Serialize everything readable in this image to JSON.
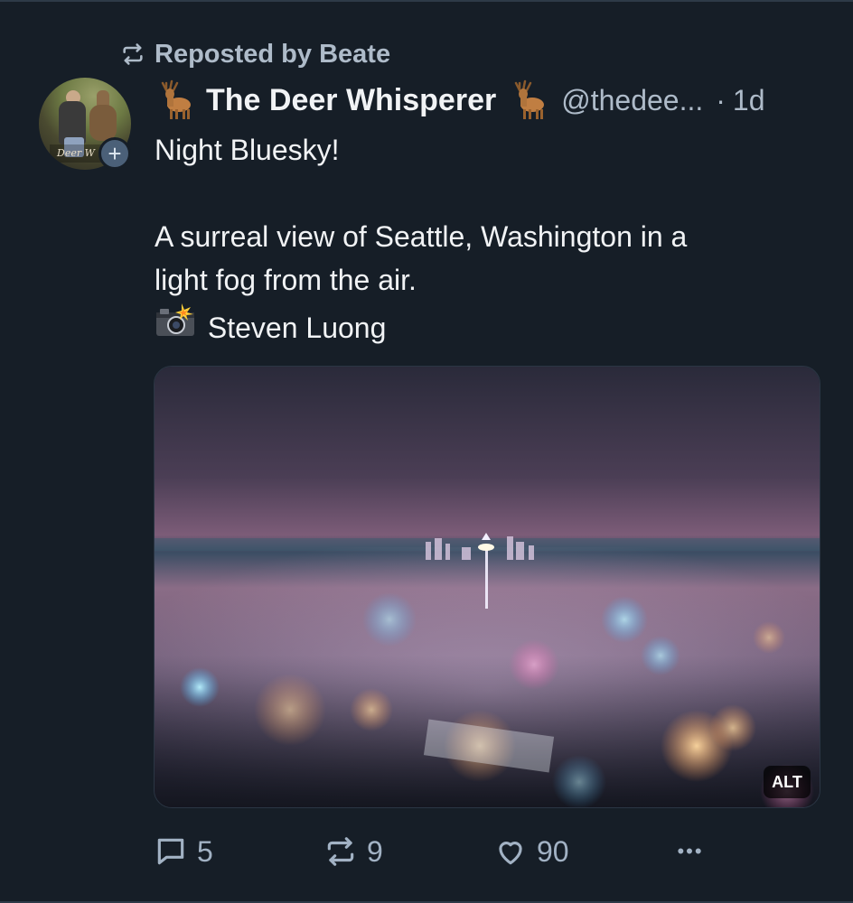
{
  "repost": {
    "text": "Reposted by Beate",
    "icon": "repost-icon"
  },
  "author": {
    "avatar_text": "Deer W",
    "display_name": "The Deer Whisperer",
    "name_emoji": "deer-emoji",
    "handle": "@thedee...",
    "separator": "·",
    "timestamp": "1d",
    "follow_icon": "plus-icon",
    "follow_glyph": "+"
  },
  "post": {
    "lines": [
      "Night Bluesky!",
      "",
      "A surreal view of Seattle, Washington in a",
      "light fog from the air.",
      "Steven Luong"
    ],
    "camera_icon": "camera-flash-icon"
  },
  "image": {
    "alt_label": "ALT"
  },
  "actions": {
    "reply_count": "5",
    "repost_count": "9",
    "like_count": "90",
    "more_label": "•••"
  },
  "colors": {
    "background": "#161e27",
    "text_primary": "#f1f3f5",
    "text_secondary": "#aebbc9",
    "action": "#a2b2c4"
  }
}
